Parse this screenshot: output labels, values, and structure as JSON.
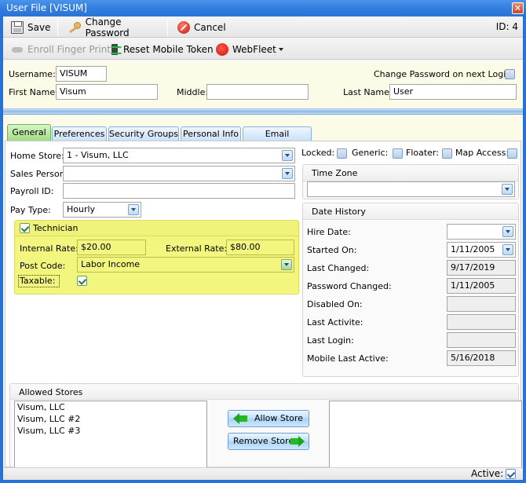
{
  "window": {
    "title": "User File [VISUM]",
    "close_icon": "close-icon"
  },
  "toolbar_main": {
    "save_label": "Save",
    "change_password_label": "Change Password",
    "cancel_label": "Cancel",
    "id_label": "ID: 4"
  },
  "toolbar_secondary": {
    "enroll_label": "Enroll Finger Print",
    "reset_token_label": "Reset Mobile Token",
    "webfleet_label": "WebFleet"
  },
  "header": {
    "username_label": "Username:",
    "username_value": "VISUM",
    "change_pw_label": "Change Password on next Login:",
    "change_pw_checked": false,
    "first_name_label": "First Name:",
    "first_name_value": "Visum",
    "middle_label": "Middle:",
    "middle_value": "",
    "last_name_label": "Last Name:",
    "last_name_value": "User"
  },
  "tabs": [
    {
      "label": "General",
      "active": true
    },
    {
      "label": "Preferences",
      "active": false
    },
    {
      "label": "Security Groups",
      "active": false
    },
    {
      "label": "Personal Info",
      "active": false
    },
    {
      "label": "Email Signature",
      "active": false
    }
  ],
  "general": {
    "home_store_label": "Home Store:",
    "home_store_value": "1 - Visum, LLC",
    "sales_person_label": "Sales Person:",
    "sales_person_value": "",
    "payroll_id_label": "Payroll ID:",
    "payroll_id_value": "",
    "pay_type_label": "Pay Type:",
    "pay_type_value": "Hourly",
    "technician": {
      "label": "Technician",
      "checked": true,
      "internal_rate_label": "Internal Rate:",
      "internal_rate_value": "$20.00",
      "external_rate_label": "External Rate:",
      "external_rate_value": "$80.00",
      "post_code_label": "Post Code:",
      "post_code_value": "Labor Income",
      "taxable_label": "Taxable:",
      "taxable_checked": true
    },
    "flags": {
      "locked_label": "Locked:",
      "generic_label": "Generic:",
      "floater_label": "Floater:",
      "map_access_label": "Map Access:"
    },
    "time_zone": {
      "title": "Time Zone",
      "value": ""
    },
    "date_history": {
      "title": "Date History",
      "rows": [
        {
          "label": "Hire Date:",
          "value": "",
          "type": "dropdown"
        },
        {
          "label": "Started On:",
          "value": "1/11/2005",
          "type": "dropdown"
        },
        {
          "label": "Last Changed:",
          "value": "9/17/2019",
          "type": "readonly"
        },
        {
          "label": "Password Changed:",
          "value": "1/11/2005",
          "type": "readonly"
        },
        {
          "label": "Disabled On:",
          "value": "",
          "type": "readonly"
        },
        {
          "label": "Last Activite:",
          "value": "",
          "type": "readonly"
        },
        {
          "label": "Last Login:",
          "value": "",
          "type": "readonly"
        },
        {
          "label": "Mobile Last Active:",
          "value": "5/16/2018",
          "type": "readonly"
        }
      ]
    },
    "allowed_stores": {
      "title": "Allowed Stores",
      "allowed": [
        "Visum, LLC",
        "Visum, LLC #2",
        "Visum, LLC #3"
      ],
      "available": [],
      "allow_button": "Allow Store",
      "remove_button": "Remove Store"
    }
  },
  "statusbar": {
    "active_label": "Active:",
    "active_checked": true
  }
}
